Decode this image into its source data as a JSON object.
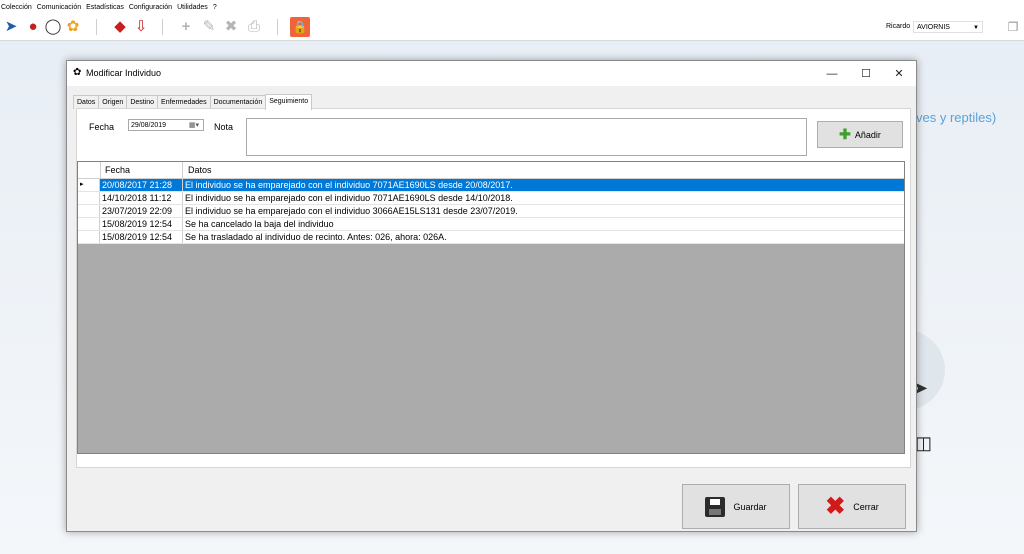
{
  "menu": [
    "Colección",
    "Comunicación",
    "Estadísticas",
    "Configuración",
    "Utilidades",
    "?"
  ],
  "toolbar": {
    "user_label": "Ricardo",
    "user_selected": "AVIORNIS"
  },
  "background": {
    "partial_text": "ves y reptiles)"
  },
  "dialog": {
    "title": "Modificar Individuo",
    "tabs": [
      "Datos",
      "Origen",
      "Destino",
      "Enfermedades",
      "Documentación",
      "Seguimiento"
    ],
    "active_tab": "Seguimiento",
    "fecha_label": "Fecha",
    "fecha_value": "29/08/2019",
    "nota_label": "Nota",
    "nota_value": "",
    "add_label": "Añadir",
    "grid": {
      "columns": [
        "Fecha",
        "Datos"
      ],
      "rows": [
        {
          "fecha": "20/08/2017 21:28",
          "datos": "El individuo se ha emparejado con el individuo 7071AE1690LS desde 20/08/2017.",
          "selected": true
        },
        {
          "fecha": "14/10/2018 11:12",
          "datos": "El individuo se ha emparejado con el individuo 7071AE1690LS desde 14/10/2018."
        },
        {
          "fecha": "23/07/2019 22:09",
          "datos": "El individuo se ha emparejado con el individuo 3066AE15LS131 desde 23/07/2019."
        },
        {
          "fecha": "15/08/2019 12:54",
          "datos": "Se ha cancelado la baja del individuo"
        },
        {
          "fecha": "15/08/2019 12:54",
          "datos": "Se ha trasladado al individuo de recinto. Antes: 026, ahora: 026A."
        }
      ]
    },
    "save_label": "Guardar",
    "close_label": "Cerrar"
  }
}
